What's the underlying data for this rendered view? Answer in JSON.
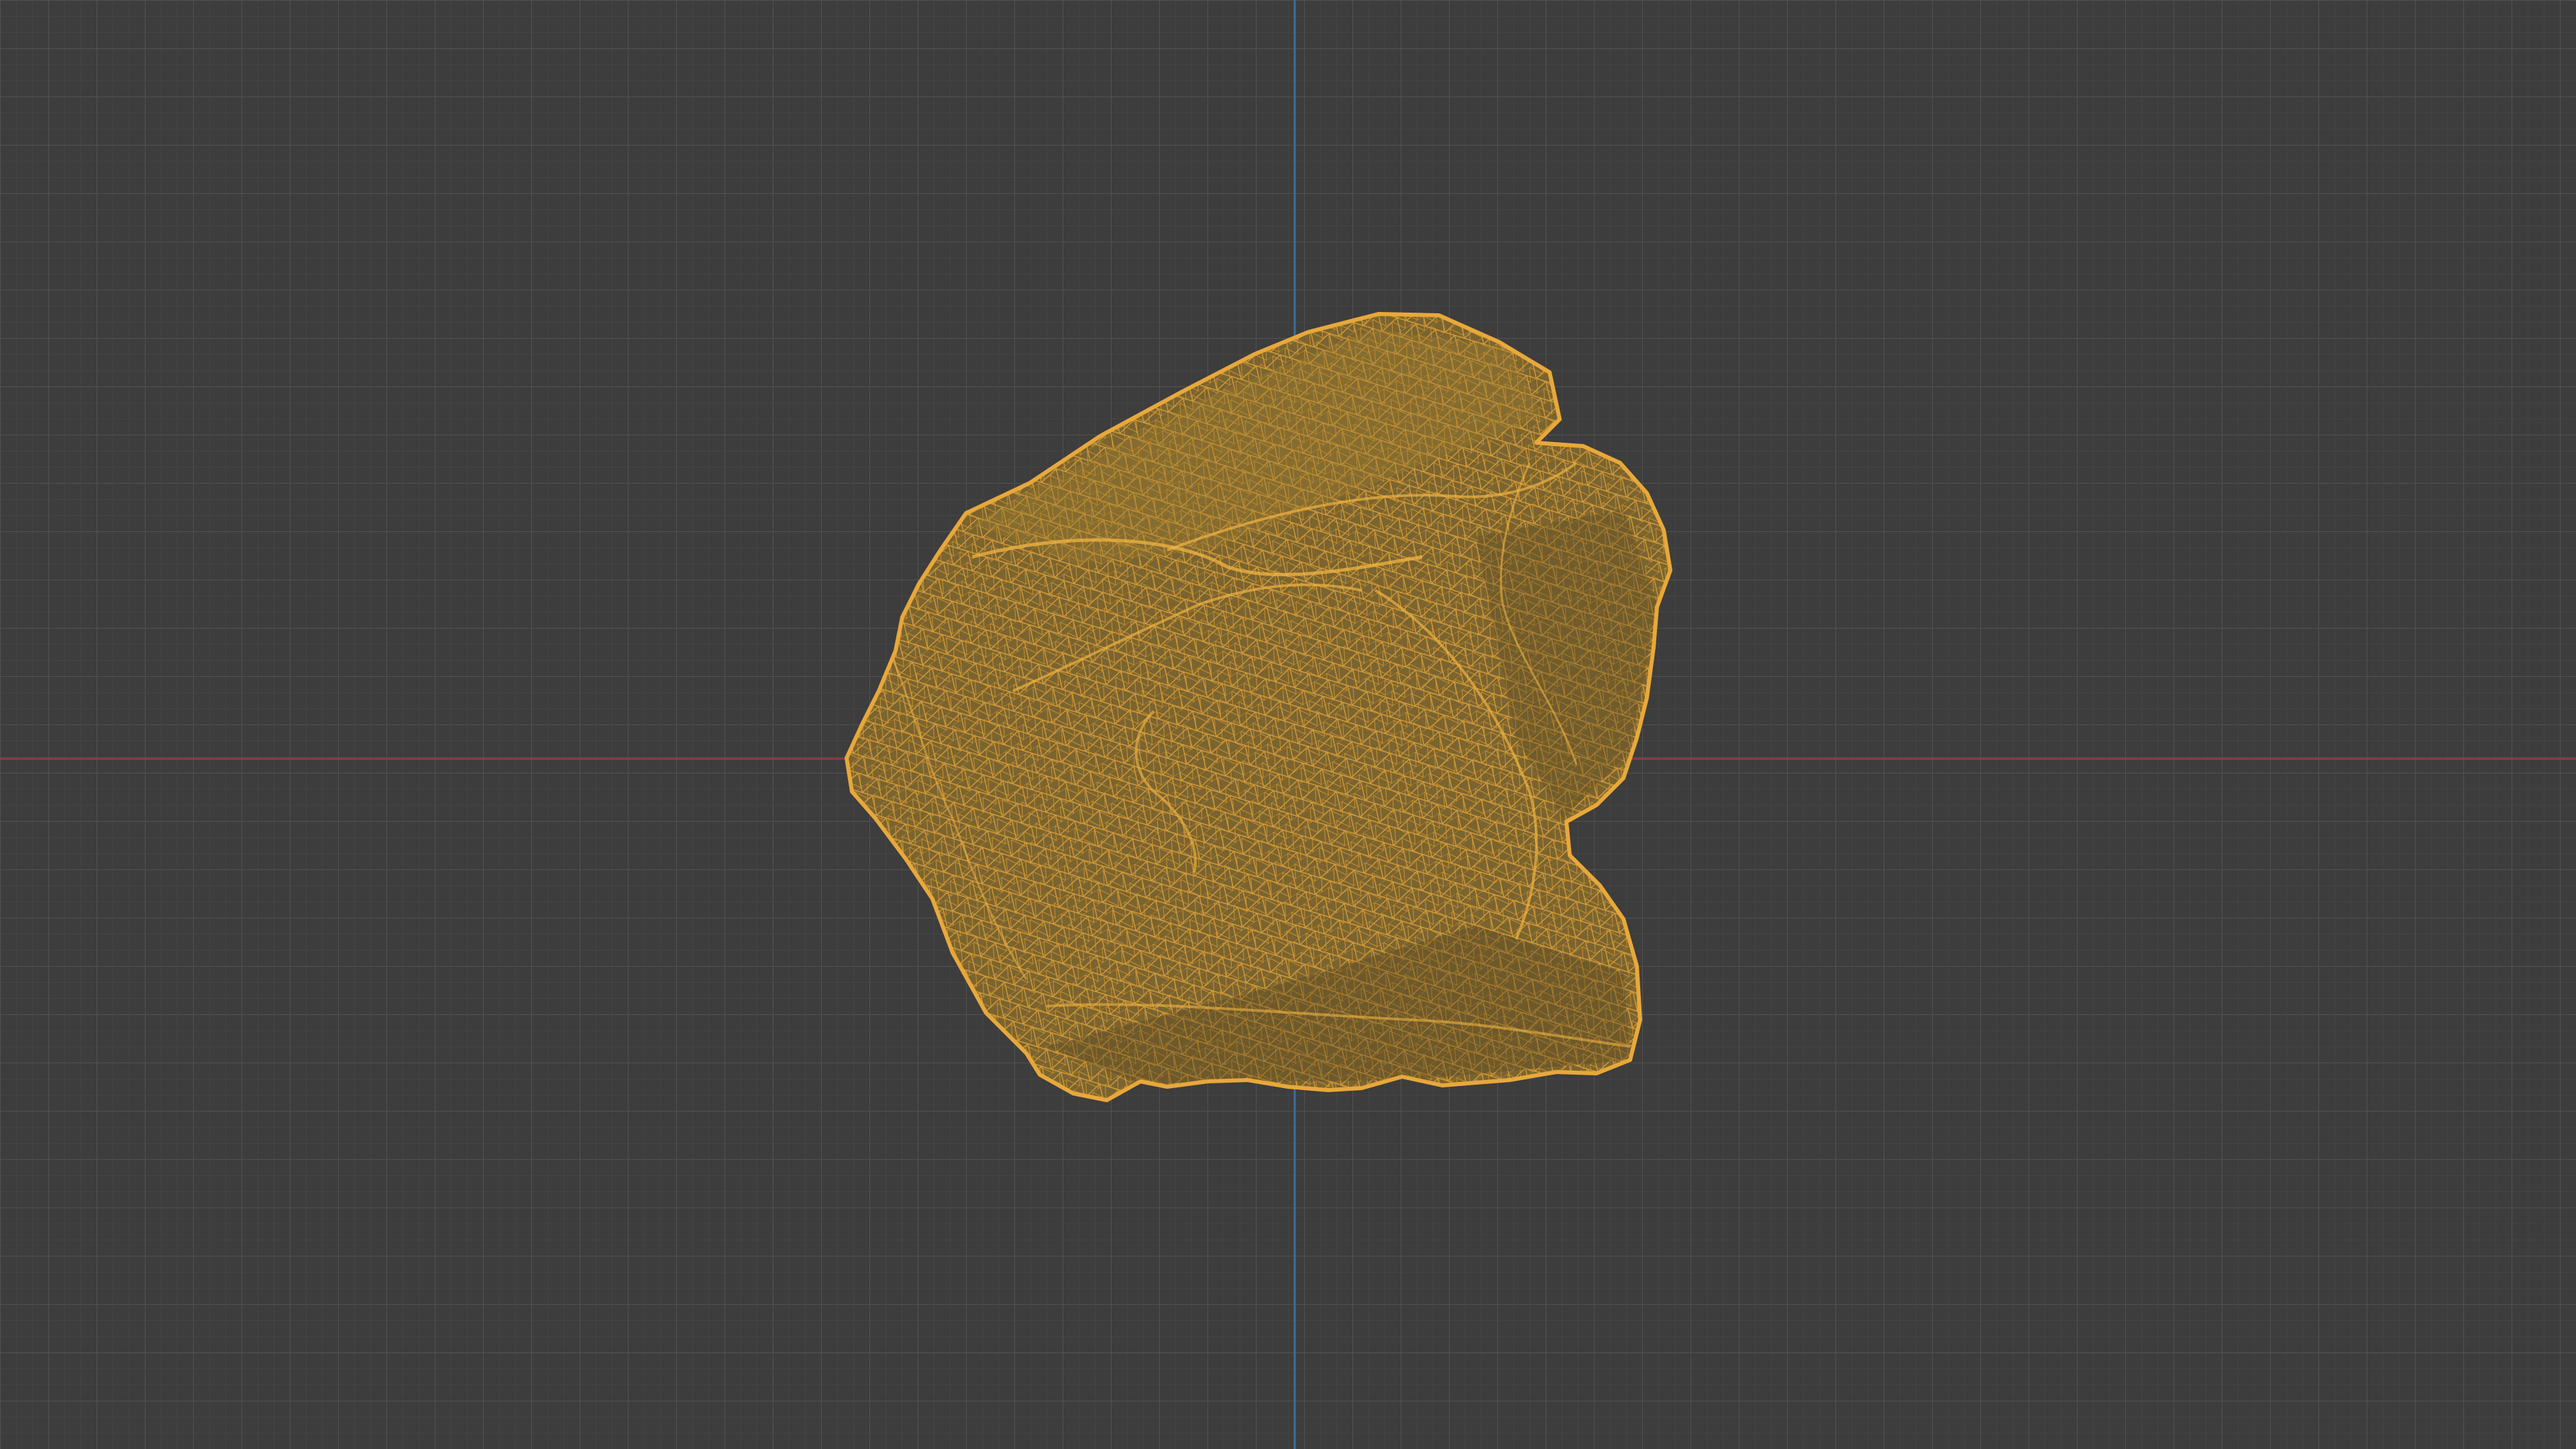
{
  "viewport": {
    "background_color": "#3d3d3d",
    "grid": {
      "visible": true,
      "minor_line_color": "#464646",
      "major_line_color": "#525252"
    },
    "axes": {
      "x_axis_color": "#8a3f49",
      "y_axis_color": "#3d6e9a"
    },
    "object": {
      "shape": "rock",
      "display_mode": "wireframe",
      "selected": true,
      "wire_color": "#e0a23a",
      "fill_color": "#7a6430"
    }
  }
}
